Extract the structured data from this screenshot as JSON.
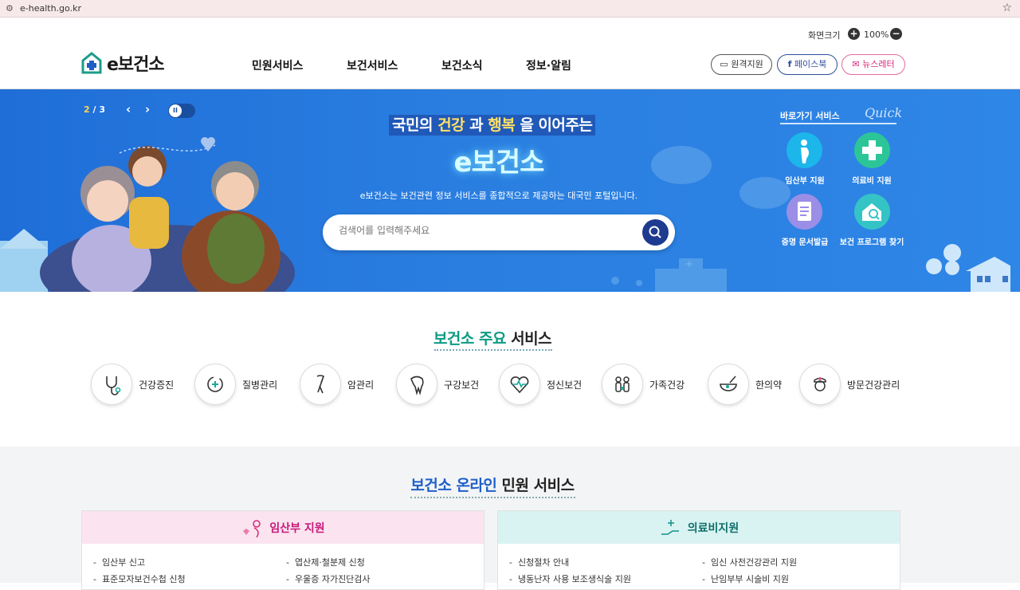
{
  "browser": {
    "url": "e-health.go.kr",
    "tune_icon": "page-info-icon",
    "star_icon": "bookmark-star-icon"
  },
  "header": {
    "zoom_label": "화면크기",
    "zoom_in": "+",
    "zoom_value": "100%",
    "zoom_out": "−",
    "logo_text": "e보건소",
    "nav": [
      "민원서비스",
      "보건서비스",
      "보건소식",
      "정보·알림"
    ],
    "util": [
      "원격지원",
      "페이스북",
      "뉴스레터"
    ]
  },
  "hero": {
    "pager_current": "2",
    "pager_sep": "/",
    "pager_total": "3",
    "prev": "‹",
    "next": "›",
    "tagline_1": "국민의 ",
    "tagline_hl1": "건강",
    "tagline_2": " 과 ",
    "tagline_hl2": "행복",
    "tagline_3": " 을 이어주는",
    "title": "e보건소",
    "desc": "e보건소는 보건관련 정보 서비스를 종합적으로 제공하는 대국민 포털입니다.",
    "search_placeholder": "검색어를 입력해주세요",
    "quick_title": "바로가기 서비스",
    "quick_sub": "Quick",
    "quick": [
      "임산부 지원",
      "의료비 지원",
      "증명 문서발급",
      "보건 프로그램 찾기"
    ]
  },
  "services": {
    "title_1": "보건소 주요",
    "title_2": " 서비스",
    "items": [
      "건강증진",
      "질병관리",
      "암관리",
      "구강보건",
      "정신보건",
      "가족건강",
      "한의약",
      "방문건강관리"
    ]
  },
  "online": {
    "title_1": "보건소 온라인",
    "title_2": " 민원 서비스",
    "card1": {
      "title": "임산부 지원",
      "items": [
        "임산부 신고",
        "엽산제·철분제 신청",
        "표준모자보건수첩 신청",
        "우울증 자가진단검사"
      ]
    },
    "card2": {
      "title": "의료비지원",
      "items": [
        "신청절차 안내",
        "임신 사전건강관리 지원",
        "냉동난자 사용 보조생식술 지원",
        "난임부부 시술비 지원"
      ]
    }
  },
  "colors": {
    "hero_blue": "#2a7ee0",
    "teal": "#0d9a83",
    "blue_title": "#1f5fc8",
    "pink": "#d8247a"
  }
}
